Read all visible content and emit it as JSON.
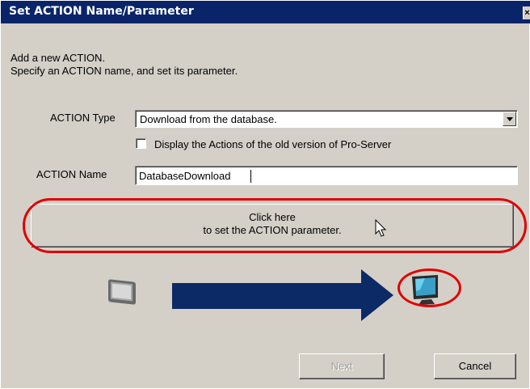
{
  "window": {
    "title": "Set ACTION Name/Parameter",
    "close_glyph": "×"
  },
  "intro": {
    "line1": "Add a new ACTION.",
    "line2": "Specify an ACTION name, and set its parameter."
  },
  "action_type": {
    "label": "ACTION Type",
    "selected": "Download from the database."
  },
  "old_version_checkbox": {
    "label": "Display the Actions of the old version of Pro-Server",
    "checked": false
  },
  "action_name": {
    "label": "ACTION Name",
    "value": "DatabaseDownload"
  },
  "parameter_button": {
    "line1": "Click here",
    "line2": "to set the ACTION parameter."
  },
  "footer": {
    "next_label": "Next",
    "cancel_label": "Cancel"
  },
  "colors": {
    "titlebar": "#0a246a",
    "dialog": "#d4d0c8",
    "highlight": "#e00000",
    "arrow": "#0b2a66"
  },
  "icons": [
    "mouse-cursor-icon",
    "display-panel-icon",
    "right-arrow-icon",
    "computer-monitor-icon"
  ]
}
